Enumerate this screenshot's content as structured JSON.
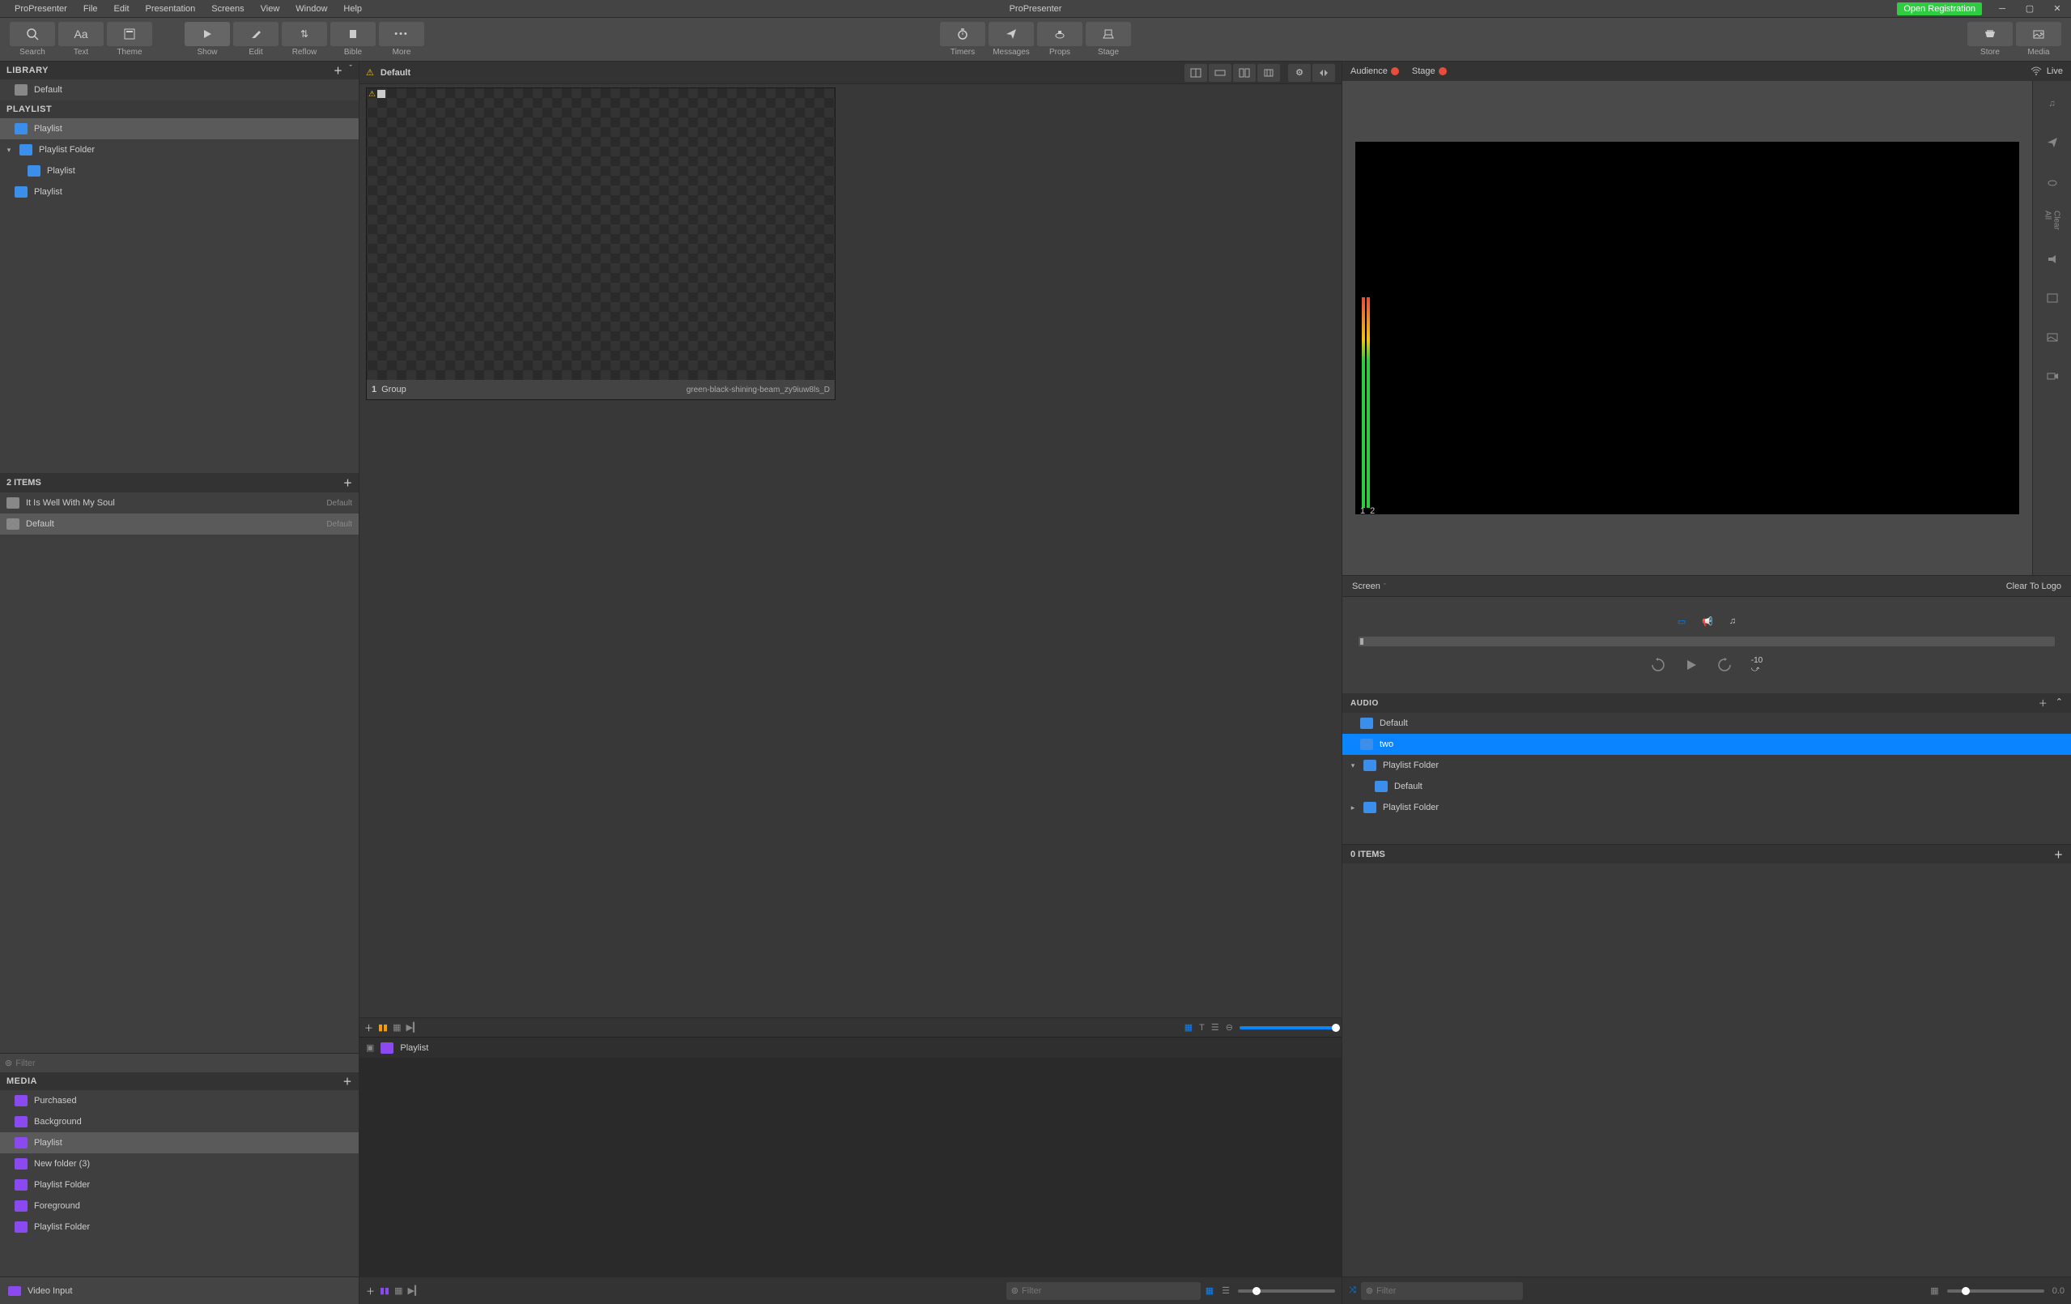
{
  "app": {
    "name": "ProPresenter",
    "title": "ProPresenter",
    "registration": "Open Registration"
  },
  "menu": [
    "ProPresenter",
    "File",
    "Edit",
    "Presentation",
    "Screens",
    "View",
    "Window",
    "Help"
  ],
  "toolbar": {
    "left": [
      {
        "id": "search",
        "label": "Search"
      },
      {
        "id": "text",
        "label": "Text"
      },
      {
        "id": "theme",
        "label": "Theme"
      }
    ],
    "show_group": [
      {
        "id": "show",
        "label": "Show"
      },
      {
        "id": "edit",
        "label": "Edit"
      },
      {
        "id": "reflow",
        "label": "Reflow"
      },
      {
        "id": "bible",
        "label": "Bible"
      },
      {
        "id": "more",
        "label": "More"
      }
    ],
    "center": [
      {
        "id": "timers",
        "label": "Timers"
      },
      {
        "id": "messages",
        "label": "Messages"
      },
      {
        "id": "props",
        "label": "Props"
      },
      {
        "id": "stage",
        "label": "Stage"
      }
    ],
    "right": [
      {
        "id": "store",
        "label": "Store"
      },
      {
        "id": "media",
        "label": "Media"
      }
    ]
  },
  "library": {
    "header": "LIBRARY",
    "items": [
      "Default"
    ],
    "playlist_header": "PLAYLIST",
    "playlists": [
      {
        "label": "Playlist",
        "type": "playlist",
        "level": 0,
        "selected": true
      },
      {
        "label": "Playlist Folder",
        "type": "folder",
        "level": 0,
        "expanded": true
      },
      {
        "label": "Playlist",
        "type": "playlist",
        "level": 1
      },
      {
        "label": "Playlist",
        "type": "playlist",
        "level": 0
      }
    ]
  },
  "items": {
    "count_label": "2 ITEMS",
    "rows": [
      {
        "label": "It Is Well With My Soul",
        "right": "Default",
        "selected": false
      },
      {
        "label": "Default",
        "right": "Default",
        "selected": true
      }
    ],
    "filter_placeholder": "Filter"
  },
  "media": {
    "header": "MEDIA",
    "items": [
      "Purchased",
      "Background",
      "Playlist",
      "New folder (3)",
      "Playlist Folder",
      "Foreground",
      "Playlist Folder"
    ],
    "selected_index": 2
  },
  "document": {
    "title": "Default",
    "slide": {
      "index": "1",
      "group": "Group",
      "filename": "green-black-shining-beam_zy9iuw8ls_D"
    }
  },
  "media_strip": {
    "breadcrumb": "Playlist",
    "filter_placeholder": "Filter"
  },
  "preview": {
    "audience": "Audience",
    "stage": "Stage",
    "live": "Live",
    "vu_channels": [
      "1",
      "2"
    ],
    "screen_label": "Screen",
    "clear_to_logo": "Clear To Logo",
    "clear_all_label": "Clear All"
  },
  "audio": {
    "header": "AUDIO",
    "items": [
      {
        "label": "Default",
        "type": "playlist",
        "level": 0
      },
      {
        "label": "two",
        "type": "playlist",
        "level": 0,
        "selected": true
      },
      {
        "label": "Playlist Folder",
        "type": "folder",
        "level": 0,
        "expanded": true
      },
      {
        "label": "Default",
        "type": "playlist",
        "level": 1
      },
      {
        "label": "Playlist Folder",
        "type": "folder",
        "level": 0,
        "expanded": false
      }
    ],
    "zero_items": "0 ITEMS",
    "filter_placeholder": "Filter",
    "time": "0.0"
  },
  "video_input": {
    "label": "Video Input"
  }
}
